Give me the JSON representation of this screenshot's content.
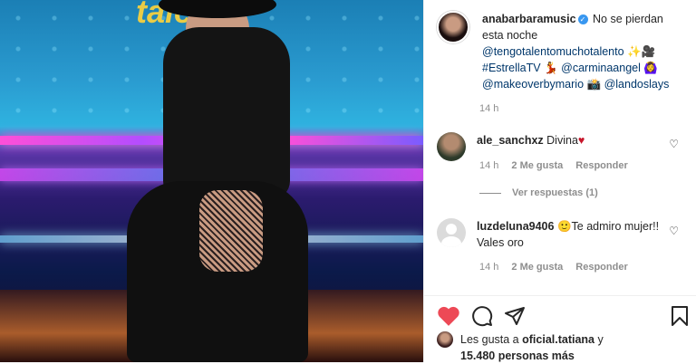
{
  "post": {
    "photo_alt": "",
    "username": "anabarbaramusic",
    "caption_lines": [
      "No se pierdan",
      "esta noche"
    ],
    "mention1": "@tengotalentomuchotalento",
    "hashtag": "#EstrellaTV",
    "mention2": "@carminaangel",
    "mention3": "@makeoverbymario",
    "mention4": "@landoslays",
    "time": "14 h"
  },
  "comments": [
    {
      "username": "ale_sanchxz",
      "text": "Divina",
      "time": "14 h",
      "likes": "2 Me gusta",
      "reply": "Responder",
      "view_replies": "Ver respuestas (1)"
    },
    {
      "username": "luzdeluna9406",
      "text": "Te admiro mujer!! Vales oro",
      "time": "14 h",
      "likes": "2 Me gusta",
      "reply": "Responder"
    }
  ],
  "likes": {
    "prefix": "Les gusta a",
    "user": "oficial.tatiana",
    "suffix": "y",
    "count": "15.480 personas más"
  },
  "colors": {
    "accent": "#ed4956",
    "link": "#00376b",
    "muted": "#8e8e8e"
  },
  "icons": [
    "heart-icon",
    "comment-icon",
    "share-icon",
    "bookmark-icon",
    "verified-icon"
  ]
}
